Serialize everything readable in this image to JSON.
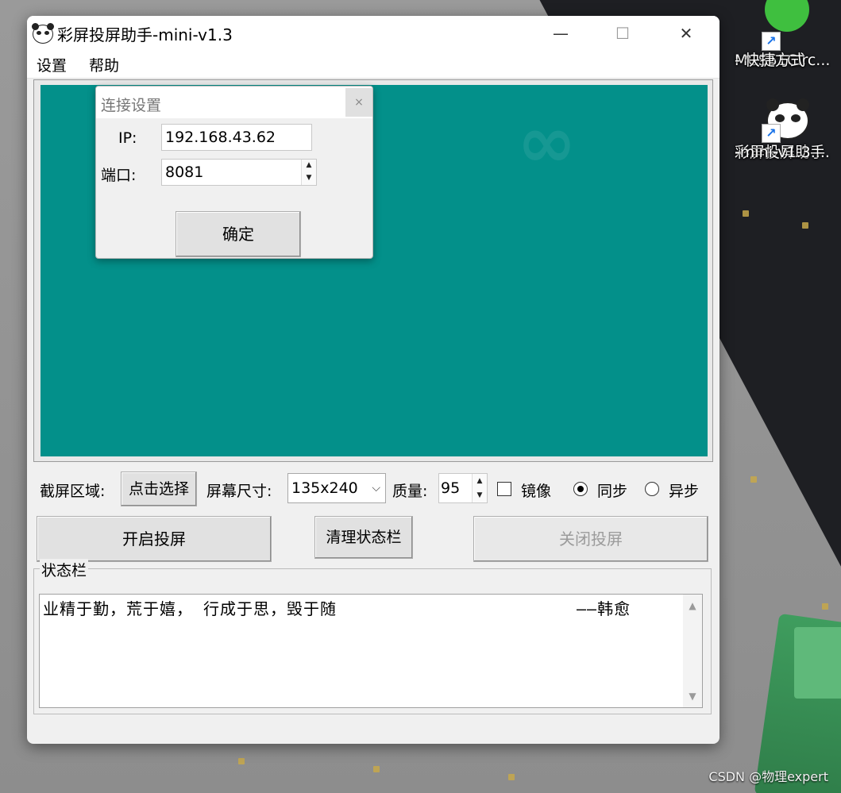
{
  "window": {
    "title": "彩屏投屏助手-mini-v1.3",
    "minimize_glyph": "—",
    "maximize_glyph": "☐",
    "close_glyph": "✕"
  },
  "menu": {
    "items": [
      {
        "label": "设置"
      },
      {
        "label": "帮助"
      }
    ]
  },
  "connection_dialog": {
    "title": "连接设置",
    "close_glyph": "×",
    "ip_label": "IP:",
    "ip_value": "192.168.43.62",
    "port_label": "端口:",
    "port_value": "8081",
    "ok_label": "确定"
  },
  "controls": {
    "capture_area_label": "截屏区域:",
    "capture_select_button": "点击选择",
    "screen_size_label": "屏幕尺寸:",
    "screen_size_value": "135x240",
    "quality_label": "质量:",
    "quality_value": "95",
    "mirror_label": "镜像",
    "mirror_checked": false,
    "sync_label": "同步",
    "async_label": "异步",
    "mode_selected": "sync",
    "start_button": "开启投屏",
    "clear_status_button": "清理状态栏",
    "stop_button": "关闭投屏",
    "stop_disabled": true
  },
  "status": {
    "legend": "状态栏",
    "line": "业精于勤，荒于嬉， 行成于思，毁于随",
    "author": "——韩愈"
  },
  "desktop": {
    "icons": [
      {
        "name": "MCS51Circ...",
        "subtitle": "- 快捷方式"
      },
      {
        "name": "彩屏投屏助手",
        "subtitle": "-mini-v1.3...."
      }
    ],
    "watermark": "CSDN @物理expert"
  },
  "colors": {
    "preview_teal": "#03908a",
    "window_bg": "#f0f0f0",
    "pcb_dark": "#1e1f23"
  }
}
